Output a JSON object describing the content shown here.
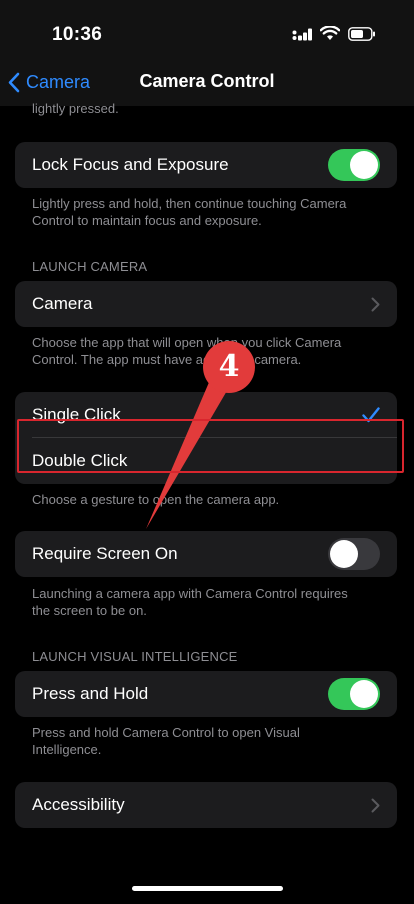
{
  "status": {
    "time": "10:36"
  },
  "nav": {
    "back_label": "Camera",
    "title": "Camera Control"
  },
  "top_footer": "lightly pressed.",
  "lock_focus": {
    "label": "Lock Focus and Exposure",
    "enabled": true,
    "footer": [
      "Lightly press and hold, then continue touching Camera",
      "Control to maintain focus and exposure."
    ]
  },
  "launch_camera": {
    "header": "LAUNCH CAMERA",
    "app_label": "Camera",
    "app_footer": [
      "Choose the app that will open when you click Camera",
      "Control. The app must have access to camera."
    ],
    "gesture_options": [
      {
        "label": "Single Click",
        "selected": true
      },
      {
        "label": "Double Click",
        "selected": false
      }
    ],
    "gesture_footer": "Choose a gesture to open the camera app.",
    "require_screen": {
      "label": "Require Screen On",
      "enabled": false,
      "footer": [
        "Launching a camera app with Camera Control requires",
        "the screen to be on."
      ]
    }
  },
  "visual_intelligence": {
    "header": "LAUNCH VISUAL INTELLIGENCE",
    "label": "Press and Hold",
    "enabled": true,
    "footer": [
      "Press and hold Camera Control to open Visual",
      "Intelligence."
    ]
  },
  "accessibility": {
    "label": "Accessibility"
  },
  "annotation": {
    "step": "4",
    "color": "#e23b3b"
  },
  "colors": {
    "accent": "#2f8bff",
    "toggle_on": "#34c759",
    "highlight": "#d9262e"
  }
}
